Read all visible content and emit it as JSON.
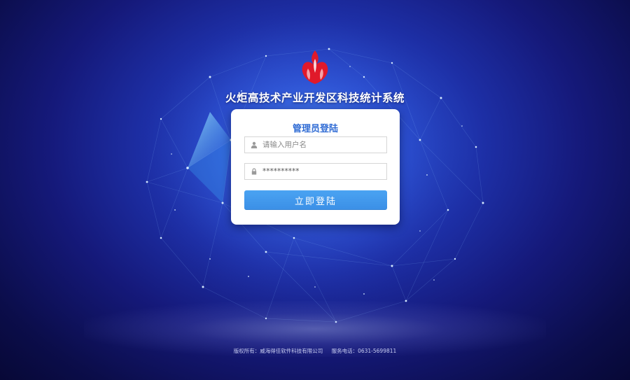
{
  "app": {
    "title": "火炬高技术产业开发区科技统计系统"
  },
  "login": {
    "title": "管理员登陆",
    "username": {
      "placeholder": "请输入用户名",
      "value": ""
    },
    "password": {
      "value": "**********"
    },
    "submit_label": "立即登陆"
  },
  "footer": {
    "copyright": "版权所有：威海得佳软件科技有限公司",
    "phone": "服务电话：0631-5699811"
  },
  "icons": {
    "logo": "torch-logo-icon",
    "username": "user-icon",
    "password": "lock-icon"
  },
  "colors": {
    "background": "#1d2fa6",
    "accent": "#3b8fe6",
    "card_title": "#2f6bd4",
    "logo": "#e0192a"
  }
}
